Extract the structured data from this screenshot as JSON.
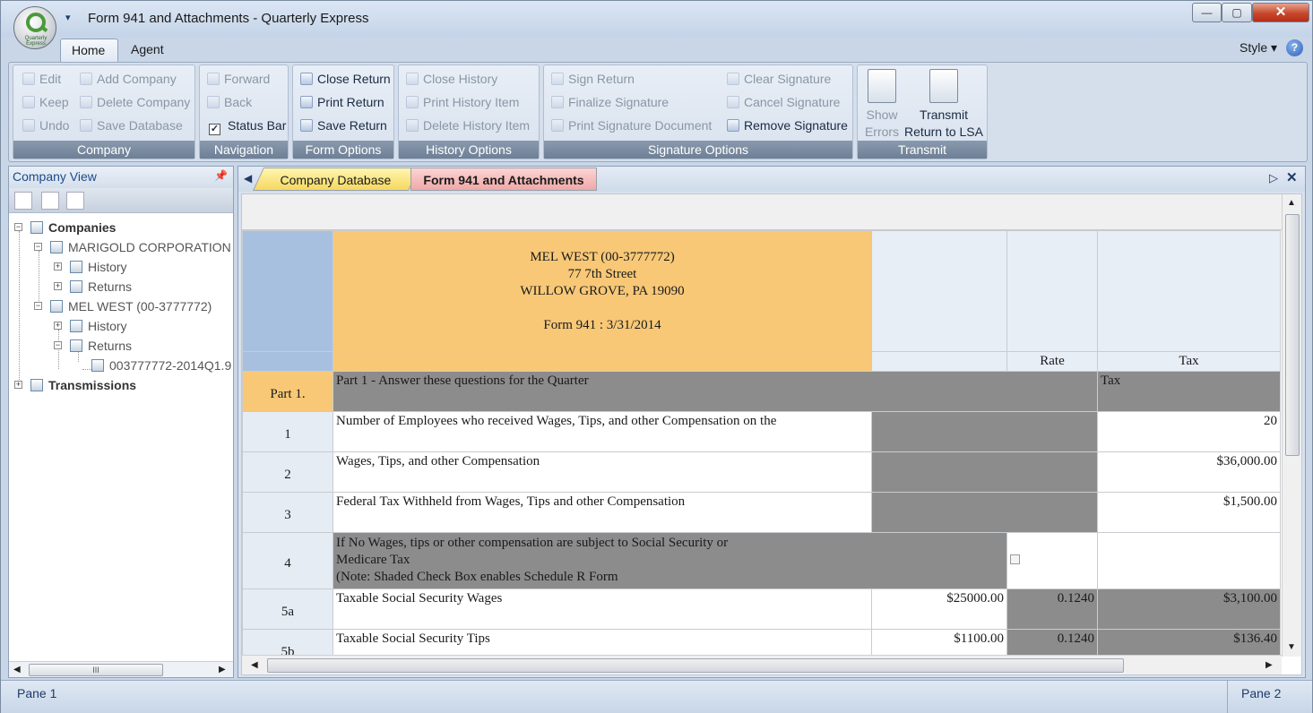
{
  "window": {
    "title": "Form 941 and Attachments - Quarterly Express",
    "logo_text": "Quarterly Express",
    "min": "—",
    "max": "▢",
    "close": "✕",
    "qat": "▾"
  },
  "ribbon_tabs": {
    "home": "Home",
    "agent": "Agent",
    "style": "Style ▾",
    "help": "?"
  },
  "groups": {
    "company": {
      "label": "Company",
      "edit": "Edit",
      "keep": "Keep",
      "undo": "Undo",
      "add": "Add Company",
      "delete": "Delete Company",
      "save": "Save Database"
    },
    "navigation": {
      "label": "Navigation",
      "forward": "Forward",
      "back": "Back",
      "status_bar": "Status Bar",
      "status_checked": "✓"
    },
    "form_options": {
      "label": "Form Options",
      "close": "Close Return",
      "print": "Print Return",
      "save": "Save Return"
    },
    "history_options": {
      "label": "History Options",
      "close": "Close History",
      "print": "Print History Item",
      "delete": "Delete History Item"
    },
    "signature_options": {
      "label": "Signature Options",
      "sign": "Sign Return",
      "finalize": "Finalize Signature",
      "print_doc": "Print Signature Document",
      "clear": "Clear Signature",
      "cancel": "Cancel Signature",
      "remove": "Remove Signature"
    },
    "transmit": {
      "label": "Transmit",
      "show_errors_1": "Show",
      "show_errors_2": "Errors",
      "transmit_1": "Transmit",
      "transmit_2": "Return to LSA"
    }
  },
  "company_view": {
    "title": "Company View",
    "pin": "📌",
    "tree": {
      "companies": "Companies",
      "marigold": "MARIGOLD CORPORATION",
      "history": "History",
      "returns": "Returns",
      "melwest": "MEL WEST (00-3777772)",
      "return_file": "003777772-2014Q1.9",
      "transmissions": "Transmissions",
      "collapse": "−",
      "expand": "+"
    },
    "scroll_grip": "III"
  },
  "doc_tabs": {
    "company_db": "Company Database",
    "form941": "Form 941 and Attachments",
    "nav_left": "◀",
    "nav_right": "▷",
    "close": "✕"
  },
  "form": {
    "header": {
      "name": "MEL WEST  (00-3777772)",
      "street": "77 7th Street",
      "city": "WILLOW GROVE, PA 19090",
      "form": "Form 941 : 3/31/2014"
    },
    "col_rate": "Rate",
    "col_tax": "Tax",
    "part1": {
      "label": "Part 1.",
      "desc": "Part 1 - Answer these questions for the Quarter",
      "tax": "Tax"
    },
    "rows": [
      {
        "num": "1",
        "desc": "Number of Employees who received Wages, Tips, and other Compensation on the",
        "tax": "20"
      },
      {
        "num": "2",
        "desc": "Wages, Tips, and other Compensation",
        "tax": "$36,000.00"
      },
      {
        "num": "3",
        "desc": "Federal Tax Withheld from Wages, Tips and other Compensation",
        "tax": "$1,500.00"
      },
      {
        "num": "4",
        "desc1": "If No Wages, tips or other compensation are subject to Social Security or",
        "desc2": "Medicare Tax",
        "desc3": "(Note: Shaded Check Box enables Schedule R Form"
      },
      {
        "num": "5a",
        "desc": "Taxable Social Security Wages",
        "amount": "$25000.00",
        "rate": "0.1240",
        "tax": "$3,100.00"
      },
      {
        "num": "5b",
        "desc": "Taxable Social Security Tips",
        "amount": "$1100.00",
        "rate": "0.1240",
        "tax": "$136.40"
      }
    ]
  },
  "status": {
    "pane1": "Pane 1",
    "pane2": "Pane 2"
  }
}
